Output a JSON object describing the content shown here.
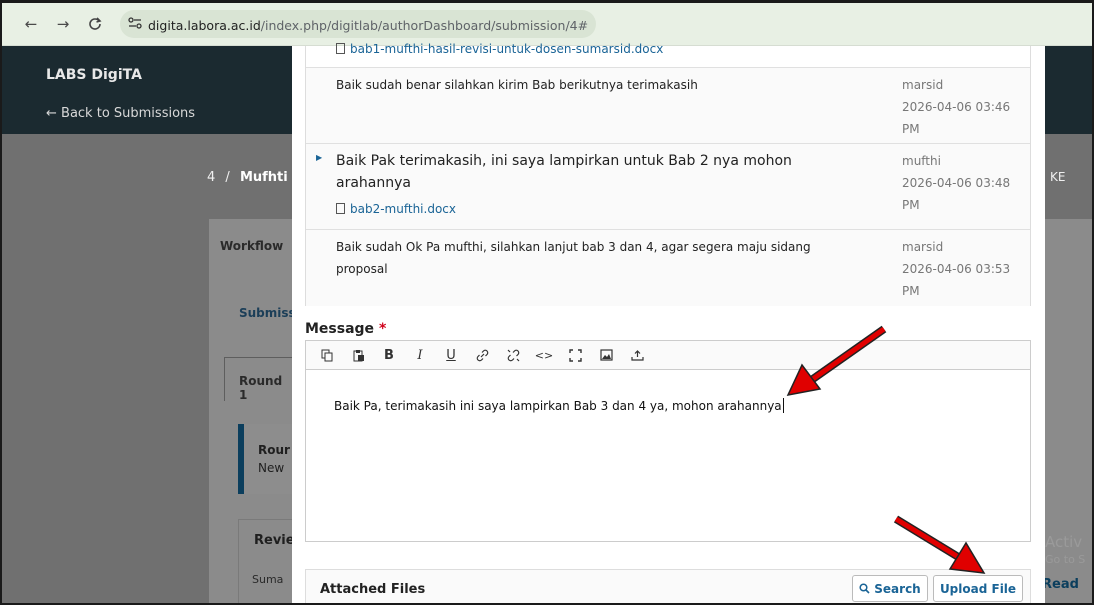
{
  "browser": {
    "back": "←",
    "forward": "→",
    "reload": "C",
    "site_info": "⚲",
    "url_host": "digita.labora.ac.id",
    "url_path": "/index.php/digitlab/authorDashboard/submission/4#"
  },
  "app": {
    "title": "LABS DigiTA",
    "back_link": "← Back to Submissions"
  },
  "page": {
    "breadcrumb_num": "4",
    "breadcrumb_sep": "/",
    "breadcrumb_title": "Mufhti S",
    "breadcrumb_right": "KE",
    "workflow_tab": "Workflow",
    "submission_tab": "Submiss",
    "round_tab": "Round 1",
    "notice_title": "Rour",
    "notice_text": "New",
    "review_heading": "Revie",
    "summary": "Suma",
    "watermark": "Activ",
    "watermark2": "Go to S",
    "read_link": "Read"
  },
  "discussion": {
    "messages": [
      {
        "file": "bab1-mufthi-hasil-revisi-untuk-dosen-sumarsid.docx"
      },
      {
        "body": "Baik sudah benar silahkan kirim Bab berikutnya terimakasih",
        "author": "marsid",
        "date": "2026-04-06 03:46",
        "time": "PM"
      },
      {
        "body_line1": "Baik Pak terimakasih, ini saya lampirkan untuk Bab 2 nya mohon",
        "body_line2": "arahannya",
        "file": "bab2-mufthi.docx",
        "author": "mufthi",
        "date": "2026-04-06 03:48",
        "time": "PM"
      },
      {
        "body_line1": "Baik sudah Ok Pa mufthi, silahkan lanjut bab 3 dan 4, agar segera maju sidang",
        "body_line2": "proposal",
        "author": "marsid",
        "date": "2026-04-06 03:53",
        "time": "PM"
      }
    ]
  },
  "form": {
    "message_label": "Message",
    "required_mark": "*",
    "message_value": "Baik Pa, terimakasih ini saya lampirkan Bab 3 dan 4 ya, mohon arahannya",
    "toolbar": [
      "copy-icon",
      "paste-icon",
      "bold-icon",
      "italic-icon",
      "underline-icon",
      "link-icon",
      "unlink-icon",
      "code-icon",
      "fullscreen-icon",
      "image-icon",
      "upload-icon"
    ],
    "attached_files_title": "Attached Files",
    "search_label": "Search",
    "upload_label": "Upload File"
  },
  "colors": {
    "accent": "#1a6496",
    "required": "#d0021b",
    "annotation_arrow": "#e00000"
  }
}
